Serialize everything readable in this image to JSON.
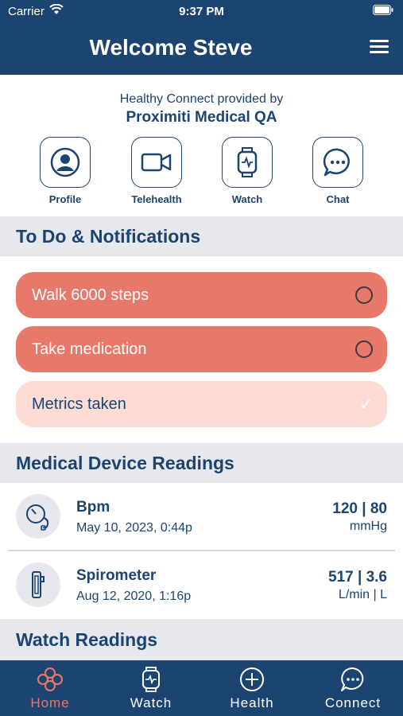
{
  "status_bar": {
    "carrier": "Carrier",
    "time": "9:37 PM"
  },
  "header": {
    "title": "Welcome Steve"
  },
  "provider": {
    "by": "Healthy Connect provided by",
    "name": "Proximiti Medical QA"
  },
  "quick_actions": [
    {
      "label": "Profile",
      "icon": "profile-icon"
    },
    {
      "label": "Telehealth",
      "icon": "video-icon"
    },
    {
      "label": "Watch",
      "icon": "watch-icon"
    },
    {
      "label": "Chat",
      "icon": "chat-icon"
    }
  ],
  "todo": {
    "title": "To Do & Notifications",
    "items": [
      {
        "label": "Walk 6000 steps",
        "status": "pending"
      },
      {
        "label": "Take medication",
        "status": "pending"
      },
      {
        "label": "Metrics taken",
        "status": "done"
      }
    ]
  },
  "medical": {
    "title": "Medical Device Readings",
    "readings": [
      {
        "name": "Bpm",
        "date": "May 10, 2023, 0:44p",
        "value": "120 | 80",
        "unit": "mmHg",
        "icon": "blood-pressure-icon"
      },
      {
        "name": "Spirometer",
        "date": "Aug 12, 2020, 1:16p",
        "value": "517 | 3.6",
        "unit": "L/min | L",
        "icon": "spirometer-icon"
      }
    ]
  },
  "watch_readings": {
    "title": "Watch Readings"
  },
  "tabbar": {
    "tabs": [
      {
        "label": "Home",
        "icon": "home-icon",
        "active": true
      },
      {
        "label": "Watch",
        "icon": "watch-icon",
        "active": false
      },
      {
        "label": "Health",
        "icon": "plus-icon",
        "active": false
      },
      {
        "label": "Connect",
        "icon": "chat-icon",
        "active": false
      }
    ]
  },
  "colors": {
    "primary": "#1c4470",
    "accent": "#e8796a",
    "accent_light": "#fcdcd4",
    "section_bg": "#e6e8ee"
  }
}
